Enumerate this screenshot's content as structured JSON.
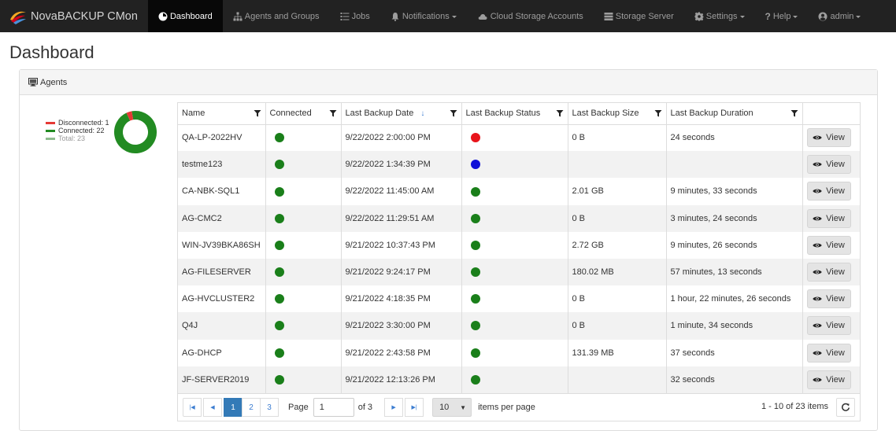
{
  "app": {
    "brand": "NovaBACKUP CMon"
  },
  "nav": {
    "dashboard": "Dashboard",
    "agents_groups": "Agents and Groups",
    "jobs": "Jobs",
    "notifications": "Notifications",
    "cloud_storage": "Cloud Storage Accounts",
    "storage_server": "Storage Server",
    "settings": "Settings",
    "help": "Help",
    "user": "admin"
  },
  "page": {
    "title": "Dashboard"
  },
  "panel": {
    "title": "Agents"
  },
  "summary": {
    "disconnected_label": "Disconnected: 1",
    "connected_label": "Connected: 22",
    "total_label": "Total: 23",
    "disconnected": 1,
    "connected": 22,
    "total": 23,
    "colors": {
      "disconnected": "#e53935",
      "connected": "#228b22",
      "total": "#8fbc8f"
    }
  },
  "grid": {
    "columns": {
      "name": "Name",
      "connected": "Connected",
      "last_backup_date": "Last Backup Date",
      "last_backup_status": "Last Backup Status",
      "last_backup_size": "Last Backup Size",
      "last_backup_duration": "Last Backup Duration"
    },
    "view_label": "View",
    "status_colors": {
      "green": "#1a7f1a",
      "red": "#e8141b",
      "blue": "#1010d8"
    },
    "rows": [
      {
        "name": "QA-LP-2022HV",
        "connected": "green",
        "date": "9/22/2022 2:00:00 PM",
        "status": "red",
        "size": "0 B",
        "duration": "24 seconds"
      },
      {
        "name": "testme123",
        "connected": "green",
        "date": "9/22/2022 1:34:39 PM",
        "status": "blue",
        "size": "",
        "duration": ""
      },
      {
        "name": "CA-NBK-SQL1",
        "connected": "green",
        "date": "9/22/2022 11:45:00 AM",
        "status": "green",
        "size": "2.01 GB",
        "duration": "9 minutes, 33 seconds"
      },
      {
        "name": "AG-CMC2",
        "connected": "green",
        "date": "9/22/2022 11:29:51 AM",
        "status": "green",
        "size": "0 B",
        "duration": "3 minutes, 24 seconds"
      },
      {
        "name": "WIN-JV39BKA86SH",
        "connected": "green",
        "date": "9/21/2022 10:37:43 PM",
        "status": "green",
        "size": "2.72 GB",
        "duration": "9 minutes, 26 seconds"
      },
      {
        "name": "AG-FILESERVER",
        "connected": "green",
        "date": "9/21/2022 9:24:17 PM",
        "status": "green",
        "size": "180.02 MB",
        "duration": "57 minutes, 13 seconds"
      },
      {
        "name": "AG-HVCLUSTER2",
        "connected": "green",
        "date": "9/21/2022 4:18:35 PM",
        "status": "green",
        "size": "0 B",
        "duration": "1 hour, 22 minutes, 26 seconds"
      },
      {
        "name": "Q4J",
        "connected": "green",
        "date": "9/21/2022 3:30:00 PM",
        "status": "green",
        "size": "0 B",
        "duration": "1 minute, 34 seconds"
      },
      {
        "name": "AG-DHCP",
        "connected": "green",
        "date": "9/21/2022 2:43:58 PM",
        "status": "green",
        "size": "131.39 MB",
        "duration": "37 seconds"
      },
      {
        "name": "JF-SERVER2019",
        "connected": "green",
        "date": "9/21/2022 12:13:26 PM",
        "status": "green",
        "size": "",
        "duration": "32 seconds"
      }
    ]
  },
  "pager": {
    "pages": [
      "1",
      "2",
      "3"
    ],
    "current_page": "1",
    "page_label": "Page",
    "page_value": "1",
    "of_label": "of 3",
    "page_size": "10",
    "items_per_page_label": "items per page",
    "info": "1 - 10 of 23 items"
  }
}
